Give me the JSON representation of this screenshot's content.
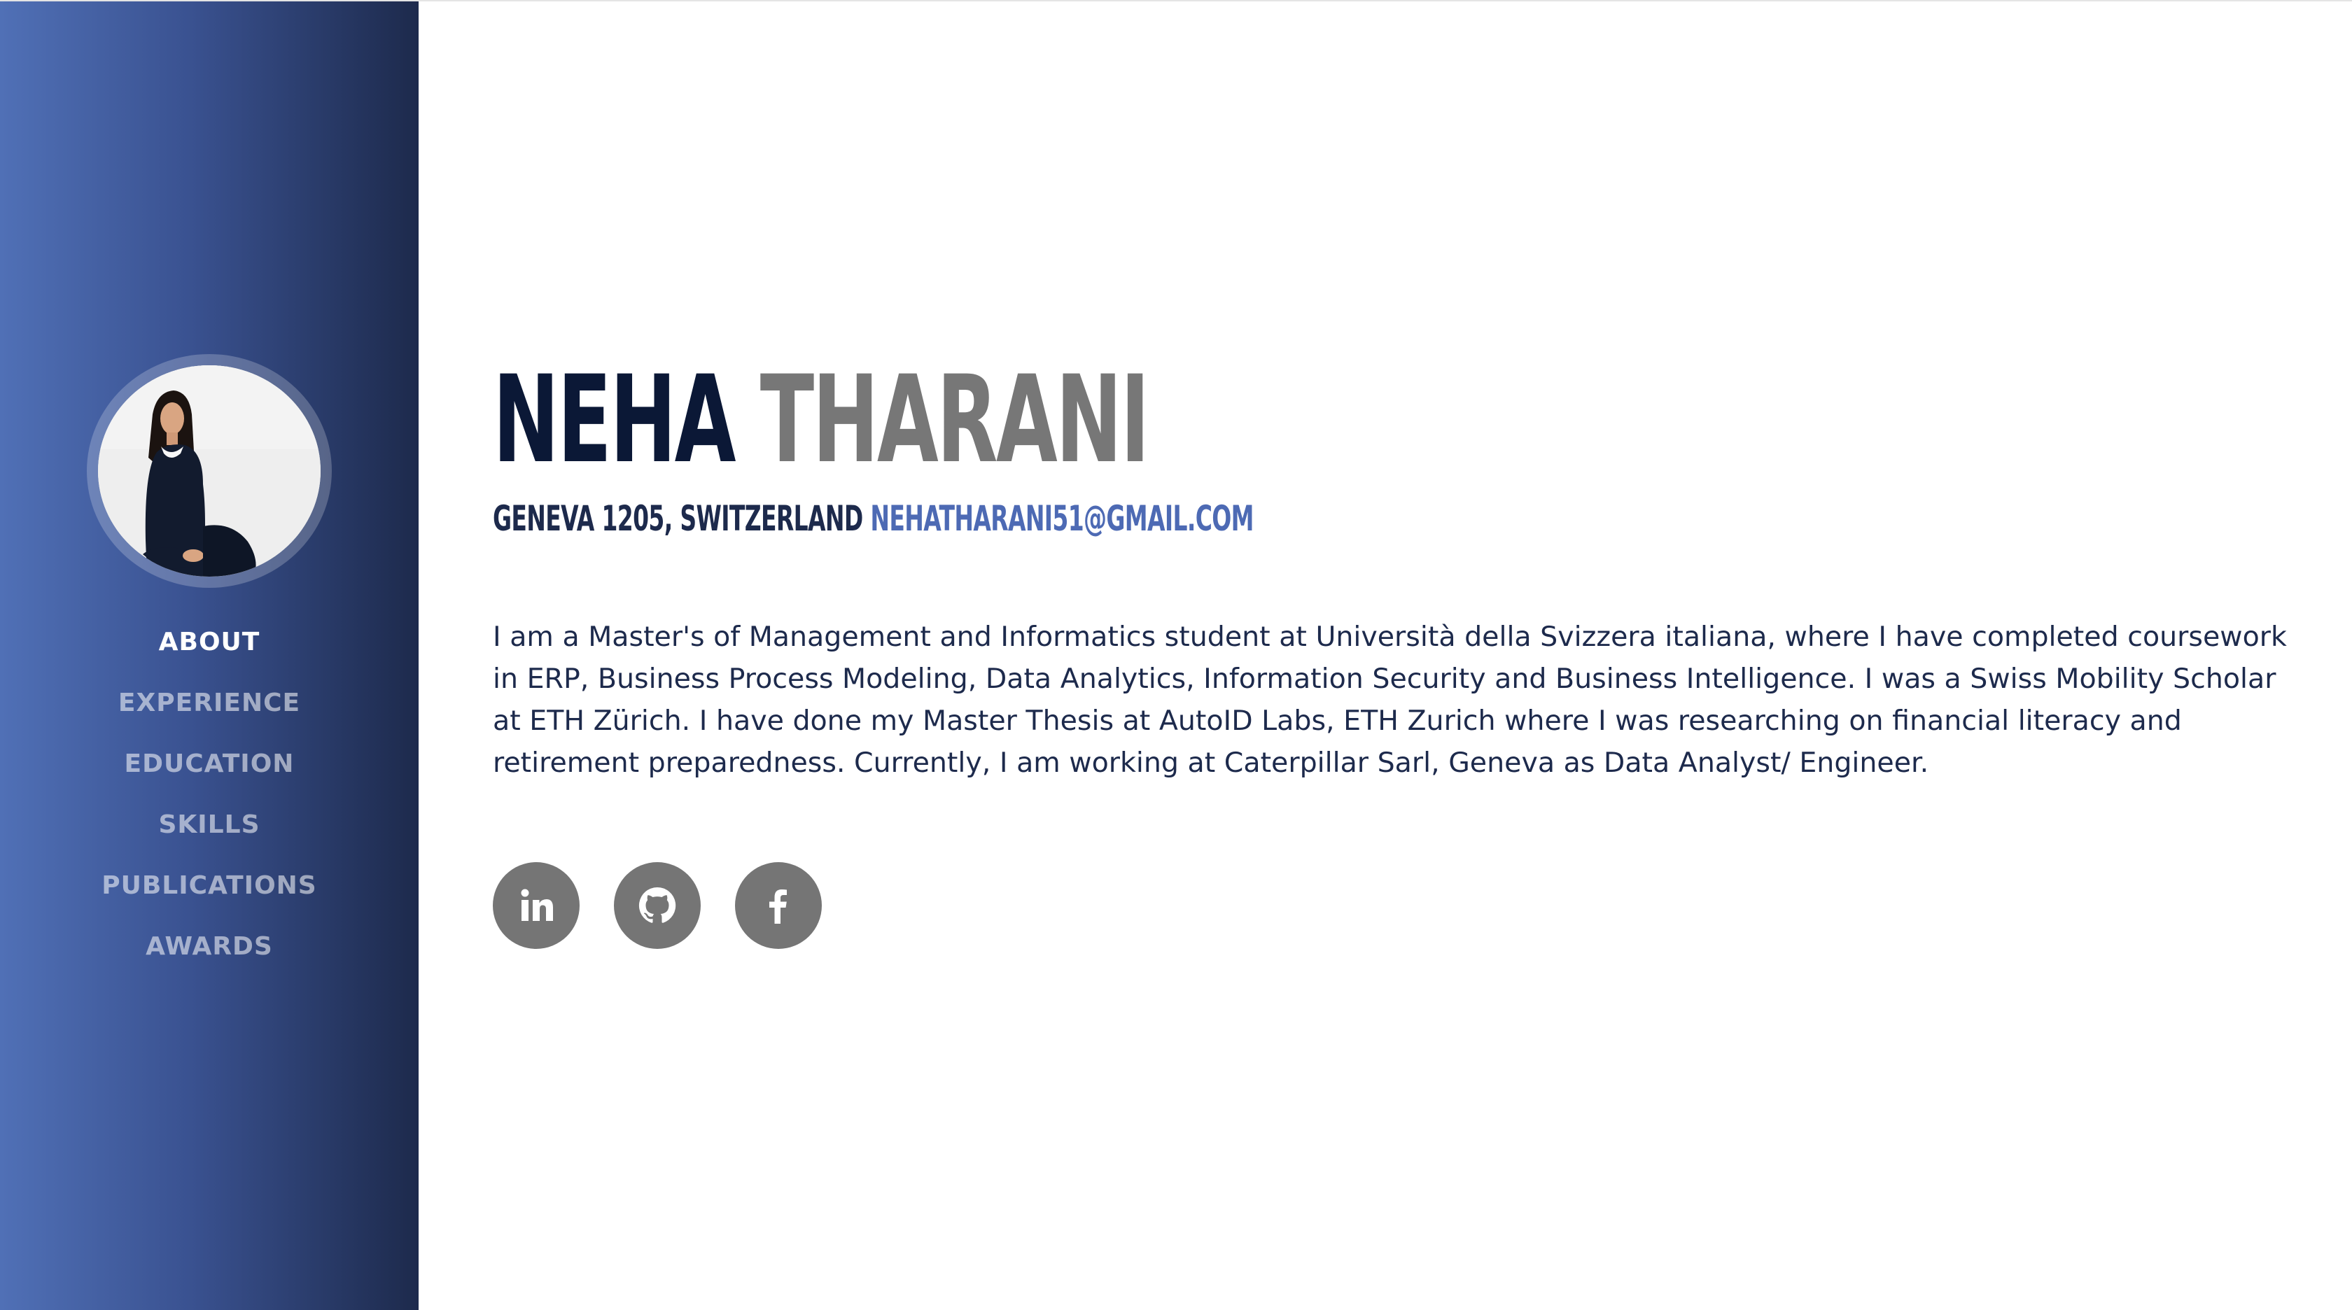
{
  "profile": {
    "first_name": "NEHA",
    "last_name": "THARANI",
    "location": "GENEVA 1205, SWITZERLAND",
    "email": "NEHATHARANI51@GMAIL.COM"
  },
  "nav": {
    "items": [
      {
        "label": "ABOUT",
        "active": true
      },
      {
        "label": "EXPERIENCE",
        "active": false
      },
      {
        "label": "EDUCATION",
        "active": false
      },
      {
        "label": "SKILLS",
        "active": false
      },
      {
        "label": "PUBLICATIONS",
        "active": false
      },
      {
        "label": "AWARDS",
        "active": false
      }
    ]
  },
  "about": {
    "lines": [
      "I am a Master's of Management and Informatics student at Università della Svizzera italiana, where I have completed coursework",
      "in ERP, Business Process Modeling, Data Analytics,  Information Security and Business Intelligence. I was a Swiss Mobility Scholar",
      "at ETH Zürich. I have done my Master Thesis at AutoID Labs, ETH Zurich where I was researching on financial literacy and",
      "retirement  preparedness. Currently, I am working at Caterpillar Sarl, Geneva as Data Analyst/ Engineer."
    ]
  },
  "social": [
    {
      "icon": "linkedin-icon"
    },
    {
      "icon": "github-icon"
    },
    {
      "icon": "facebook-icon"
    }
  ],
  "colors": {
    "sidebar_light": "#5070b6",
    "sidebar_dark": "#1d2a4c",
    "name_dark": "#0b1836",
    "name_gray": "#777777",
    "accent": "#4d6ab4",
    "social_bg": "#757575"
  }
}
